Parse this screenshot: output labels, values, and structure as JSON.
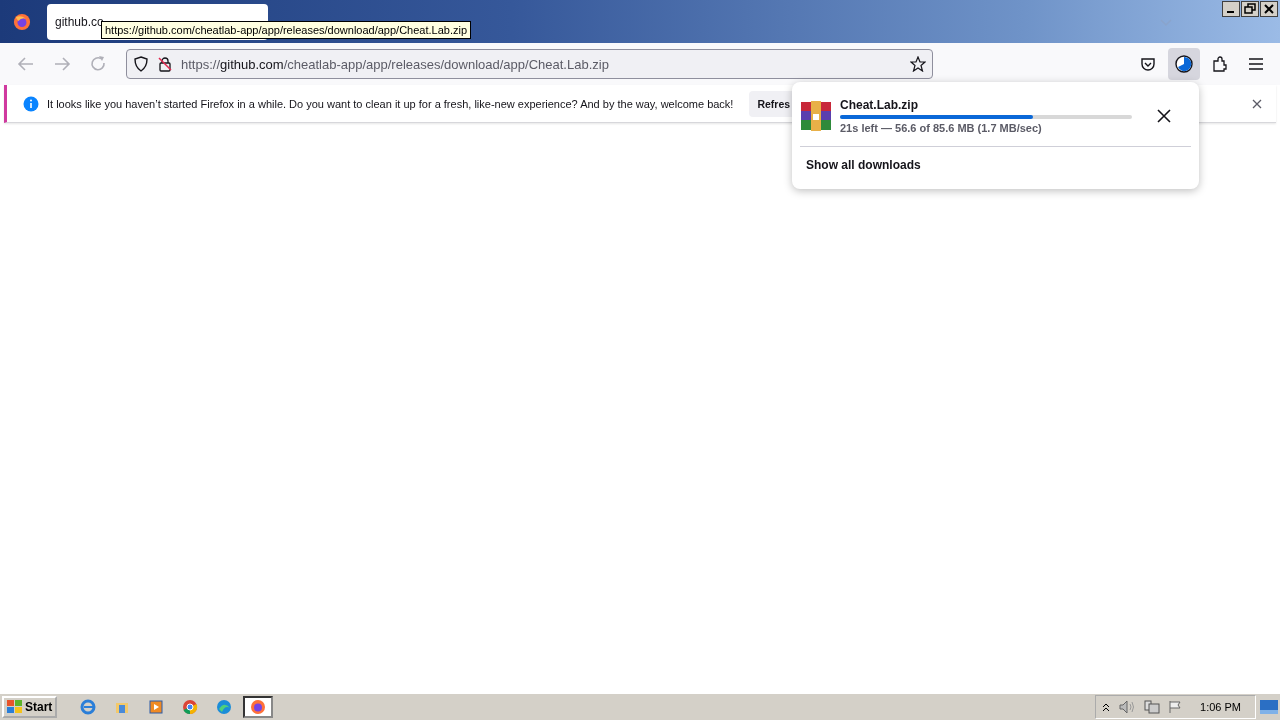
{
  "tab": {
    "title": "github.co"
  },
  "tooltip": "https://github.com/cheatlab-app/app/releases/download/app/Cheat.Lab.zip",
  "address_bar": {
    "scheme": "https://",
    "domain": "github.com",
    "path": "/cheatlab-app/app/releases/download/app/Cheat.Lab.zip"
  },
  "notification": {
    "message": "It looks like you haven’t started Firefox in a while. Do you want to clean it up for a fresh, like-new experience? And by the way, welcome back!",
    "button": "Refres"
  },
  "downloads_panel": {
    "file_name": "Cheat.Lab.zip",
    "level": 0.66,
    "status": "21s left — 56.6 of 85.6 MB (1.7 MB/sec)",
    "show_all": "Show all downloads"
  },
  "taskbar": {
    "start": "Start",
    "apps": [
      {
        "kind": "ie",
        "selected": false
      },
      {
        "kind": "folder",
        "selected": false
      },
      {
        "kind": "media",
        "selected": false
      },
      {
        "kind": "chrome",
        "selected": false
      },
      {
        "kind": "edge",
        "selected": false
      },
      {
        "kind": "firefox",
        "selected": true
      }
    ],
    "clock": "1:06 PM"
  }
}
